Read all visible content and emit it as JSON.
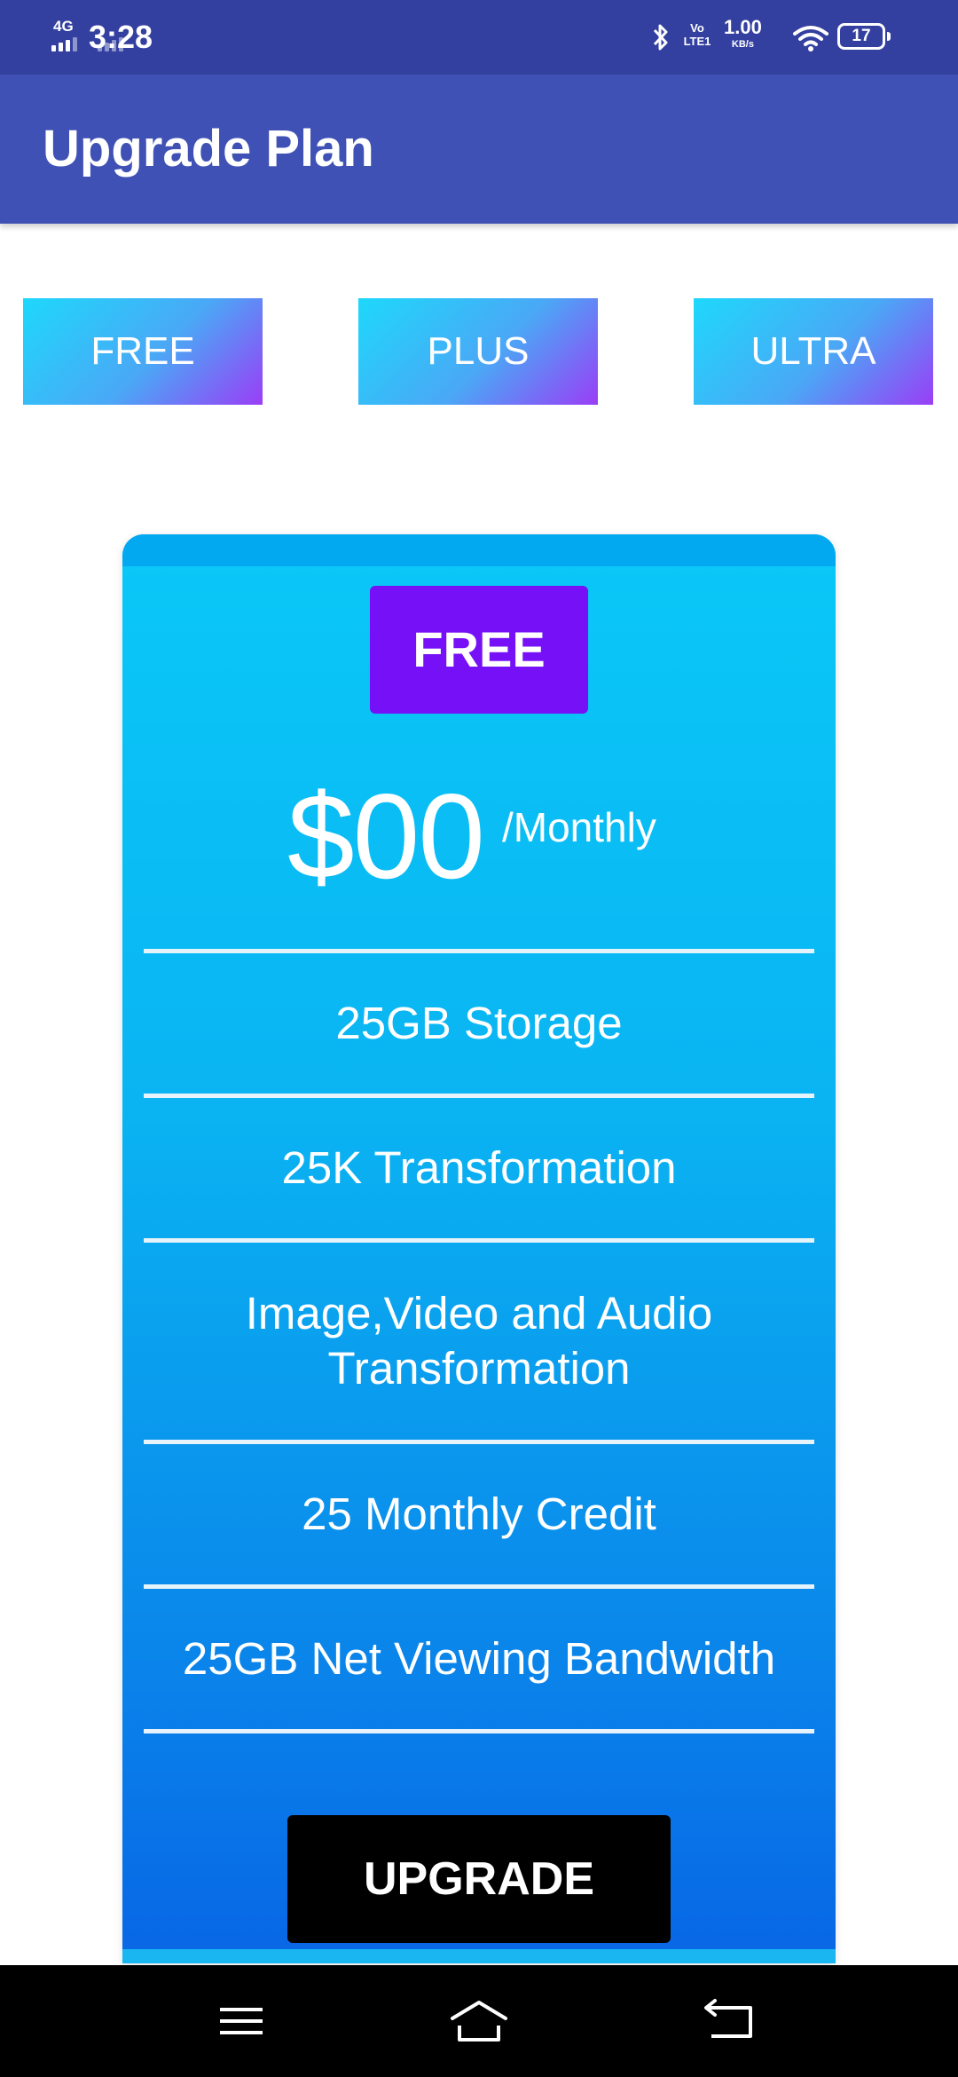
{
  "status_bar": {
    "network_type": "4G",
    "time": "3:28",
    "volte_label": "Vo LTE1",
    "speed_value": "1.00",
    "speed_unit": "KB/s",
    "battery_level": "17",
    "icons": [
      "signal-icon",
      "bluetooth-icon",
      "wifi-icon",
      "battery-icon"
    ]
  },
  "app_bar": {
    "title": "Upgrade Plan",
    "color": "#3f51b5"
  },
  "plan_tabs": [
    {
      "label": "FREE"
    },
    {
      "label": "PLUS"
    },
    {
      "label": "ULTRA"
    }
  ],
  "plan_card": {
    "plan_name": "FREE",
    "price": "$00",
    "period": "/Monthly",
    "features": [
      "25GB Storage",
      "25K Transformation",
      "Image,Video and Audio Transformation",
      "25 Monthly Credit",
      "25GB Net Viewing Bandwidth"
    ],
    "action_label": "UPGRADE",
    "badge_color": "#7510f7",
    "card_color": "#0ab4f2"
  },
  "nav_bar": {
    "icons": [
      "menu-icon",
      "home-icon",
      "back-icon"
    ]
  }
}
